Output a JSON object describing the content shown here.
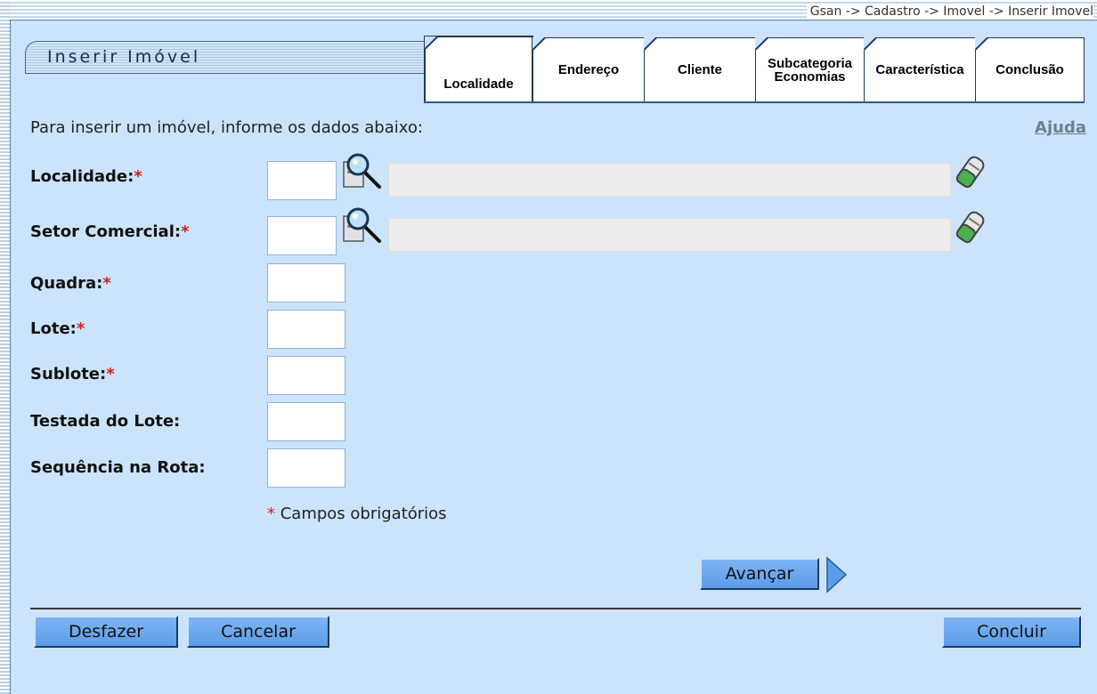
{
  "breadcrumb": "Gsan -> Cadastro -> Imovel -> Inserir Imovel",
  "title": "Inserir Imóvel",
  "tabs": [
    {
      "label": "Localidade",
      "active": true
    },
    {
      "label": "Endereço",
      "active": false
    },
    {
      "label": "Cliente",
      "active": false
    },
    {
      "label": "Subcategoria\nEconomias",
      "active": false
    },
    {
      "label": "Característica",
      "active": false
    },
    {
      "label": "Conclusão",
      "active": false
    }
  ],
  "intro_text": "Para inserir um imóvel, informe os dados abaixo:",
  "help_link": "Ajuda",
  "fields": {
    "localidade": {
      "label": "Localidade:",
      "required_mark": "*",
      "value": "",
      "description": ""
    },
    "setor_comercial": {
      "label": "Setor Comercial:",
      "required_mark": "*",
      "value": "",
      "description": ""
    },
    "quadra": {
      "label": "Quadra:",
      "required_mark": "*",
      "value": ""
    },
    "lote": {
      "label": "Lote:",
      "required_mark": "*",
      "value": ""
    },
    "sublote": {
      "label": "Sublote:",
      "required_mark": "*",
      "value": ""
    },
    "testada_lote": {
      "label": "Testada do Lote:",
      "value": ""
    },
    "sequencia_rota": {
      "label": "Sequência na Rota:",
      "value": ""
    }
  },
  "legend": {
    "mark": "*",
    "text": " Campos obrigatórios"
  },
  "buttons": {
    "avancar": "Avançar",
    "desfazer": "Desfazer",
    "cancelar": "Cancelar",
    "concluir": "Concluir"
  },
  "icons": {
    "search": "magnifier-search-icon",
    "clear": "eraser-clear-icon",
    "next": "arrow-right-icon"
  },
  "colors": {
    "background": "#cbe4fb",
    "required": "#d61b1b",
    "button": "#6aa6ee"
  }
}
